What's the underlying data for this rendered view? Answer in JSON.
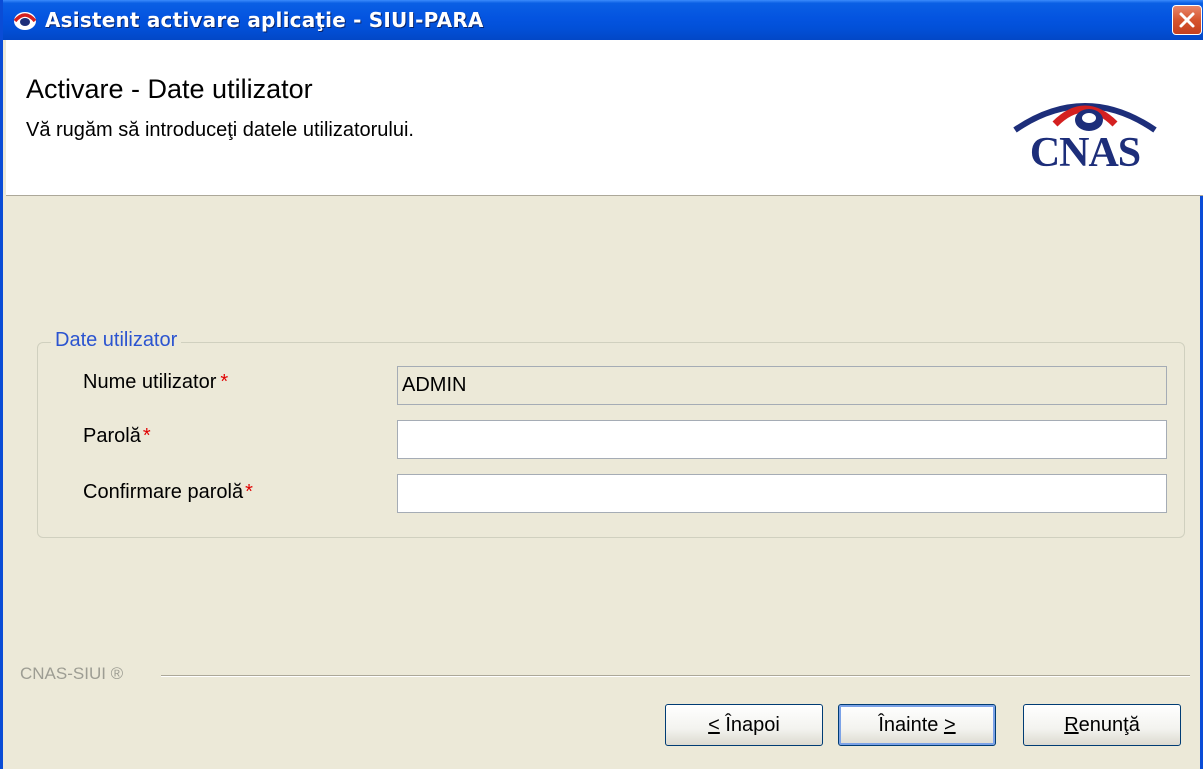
{
  "window": {
    "title": "Asistent activare aplicaţie - SIUI-PARA"
  },
  "header": {
    "title": "Activare - Date utilizator",
    "subtitle": "Vă rugăm să introduceţi datele utilizatorului.",
    "logo_text": "CNAS"
  },
  "group": {
    "legend": "Date utilizator",
    "fields": [
      {
        "label": "Nume utilizator",
        "required_mark": "*",
        "value": "ADMIN",
        "readonly": true
      },
      {
        "label": "Parolă",
        "required_mark": "*",
        "value": "",
        "readonly": false
      },
      {
        "label": "Confirmare parolă",
        "required_mark": "*",
        "value": "",
        "readonly": false
      }
    ]
  },
  "footer": {
    "brand": "CNAS-SIUI ®",
    "buttons": {
      "back": {
        "mnemonic": "<",
        "label": " Înapoi"
      },
      "next": {
        "label": "Înainte ",
        "mnemonic": ">"
      },
      "cancel": {
        "mnemonic": "R",
        "label": "enunţă"
      }
    }
  },
  "colors": {
    "titlebar": "#0454e0",
    "legend": "#2b54d0",
    "required": "#e00000",
    "logo": "#1d2e7a",
    "logo_accent": "#d42020"
  },
  "icons": {
    "title": "app-logo-icon",
    "close": "close-icon"
  }
}
